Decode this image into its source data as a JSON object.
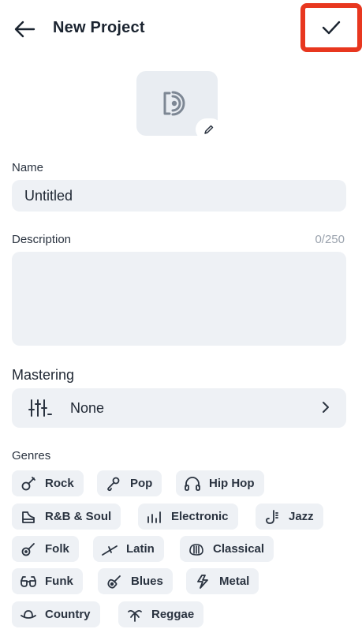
{
  "header": {
    "title": "New Project"
  },
  "form": {
    "name_label": "Name",
    "name_value": "Untitled",
    "description_label": "Description",
    "description_counter": "0/250",
    "description_value": ""
  },
  "mastering": {
    "section_title": "Mastering",
    "value": "None"
  },
  "genres": {
    "label": "Genres",
    "items": [
      {
        "label": "Rock",
        "icon": "guitar-icon"
      },
      {
        "label": "Pop",
        "icon": "microphone-icon"
      },
      {
        "label": "Hip Hop",
        "icon": "headphones-icon"
      },
      {
        "label": "R&B & Soul",
        "icon": "piano-icon"
      },
      {
        "label": "Electronic",
        "icon": "equalizer-bars-icon"
      },
      {
        "label": "Jazz",
        "icon": "saxophone-icon"
      },
      {
        "label": "Folk",
        "icon": "banjo-icon"
      },
      {
        "label": "Latin",
        "icon": "maracas-icon"
      },
      {
        "label": "Classical",
        "icon": "harp-icon"
      },
      {
        "label": "Funk",
        "icon": "sunglasses-icon"
      },
      {
        "label": "Blues",
        "icon": "acoustic-guitar-icon"
      },
      {
        "label": "Metal",
        "icon": "lightning-icon"
      },
      {
        "label": "Country",
        "icon": "cowboy-hat-icon"
      },
      {
        "label": "Reggae",
        "icon": "palm-tree-icon"
      }
    ]
  },
  "colors": {
    "highlight": "#e8371f",
    "field_bg": "#eef1f5",
    "icon": "#2a3340"
  }
}
